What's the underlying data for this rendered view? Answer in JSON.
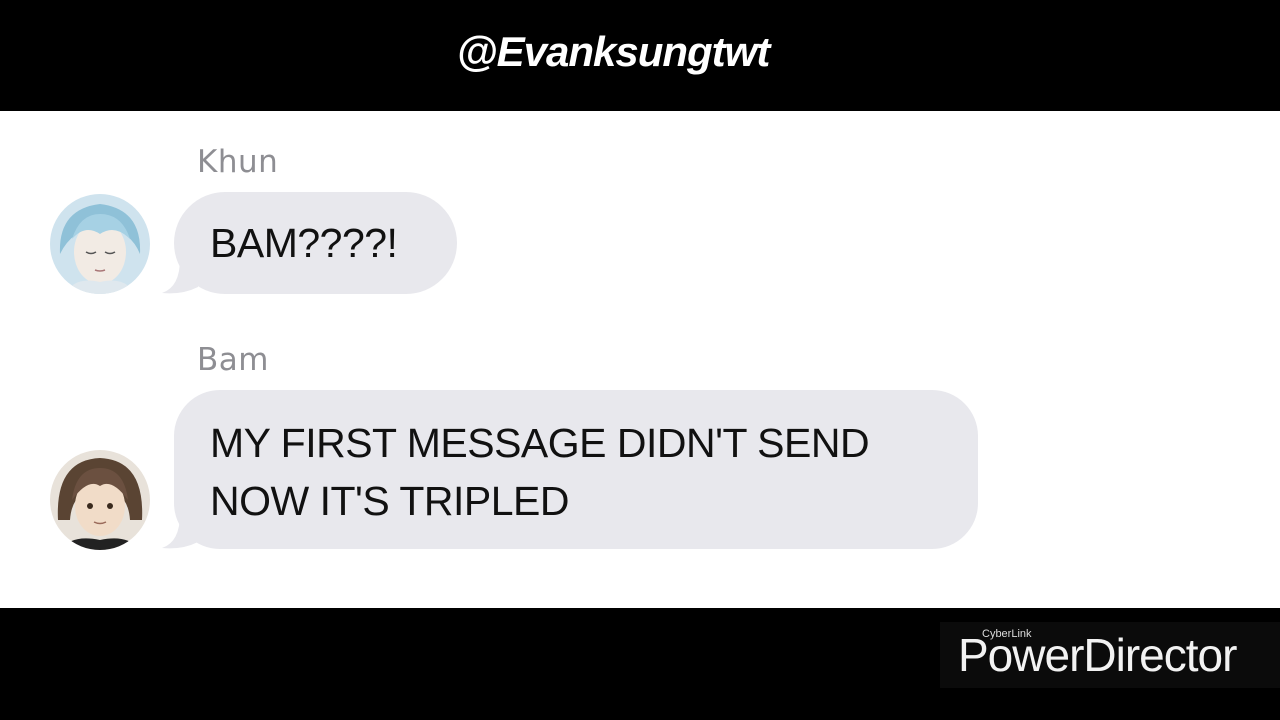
{
  "header": {
    "handle": "@Evanksungtwt"
  },
  "messages": [
    {
      "sender": "Khun",
      "avatar_icon": "khun-avatar",
      "lines": [
        "BAM????!"
      ]
    },
    {
      "sender": "Bam",
      "avatar_icon": "bam-avatar",
      "lines": [
        "MY FIRST MESSAGE DIDN'T SEND",
        "NOW IT'S TRIPLED"
      ]
    }
  ],
  "watermark": {
    "small": "CyberLink",
    "big": "PowerDirector"
  },
  "colors": {
    "bubble": "#e8e8ed",
    "sender_name": "#8e8e93",
    "background": "#ffffff",
    "letterbox": "#000000"
  }
}
